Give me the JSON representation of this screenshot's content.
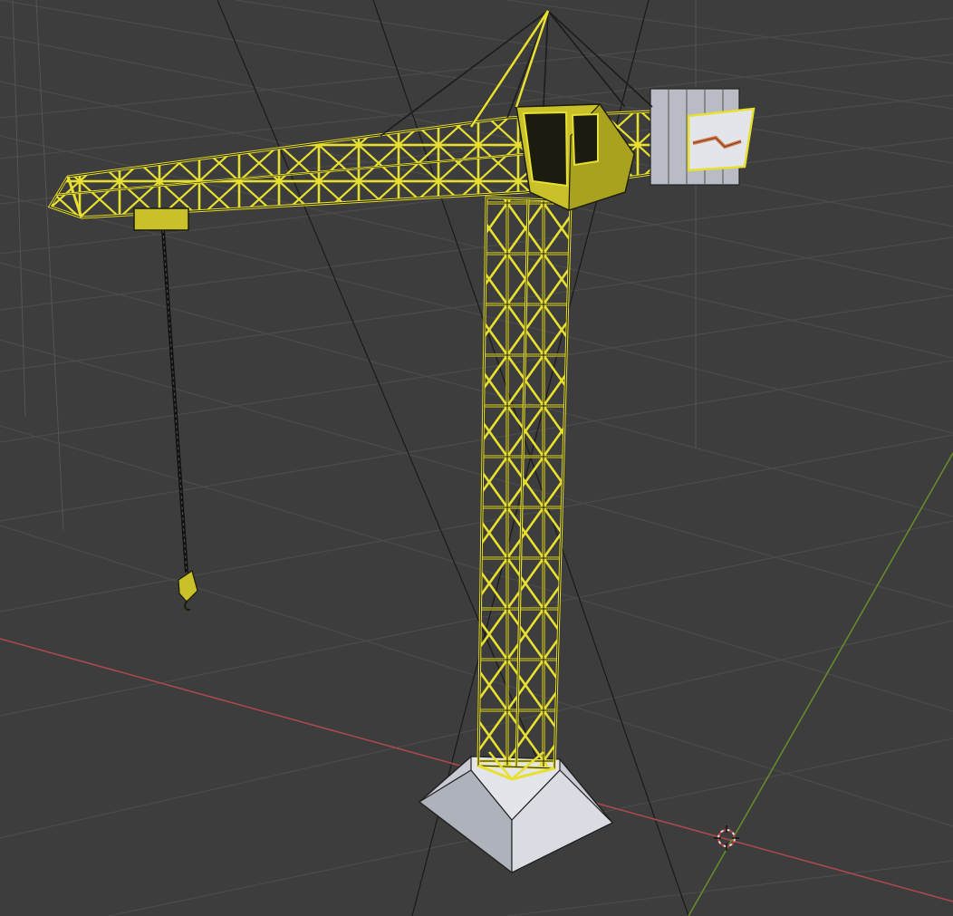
{
  "viewport": {
    "background": "#3d3d3d",
    "grid_color": "#4a4a4a",
    "x_axis_color": "#b0494f",
    "y_axis_color": "#6a8e2a"
  },
  "scene": {
    "object": "tower-crane",
    "selected_wire_color": "#e8e030",
    "crane_fill": "#c9c12a",
    "crane_dark": "#8c8616",
    "base_fill": "#c8cbd3",
    "cable_color": "#222222",
    "accent_stripe": "#d07a4a"
  },
  "gizmos": {
    "3d_cursor": "crosshair-target-icon"
  }
}
